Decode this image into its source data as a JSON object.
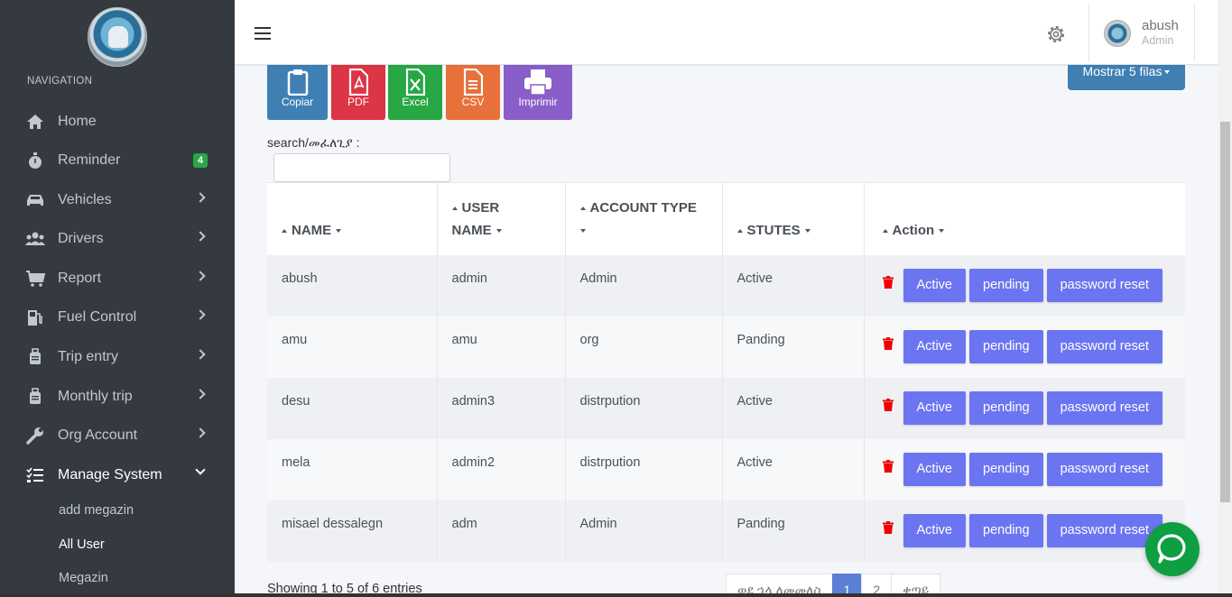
{
  "sidebar": {
    "nav_header": "NAVIGATION",
    "items": [
      {
        "label": "Home",
        "icon": "home-icon"
      },
      {
        "label": "Reminder",
        "icon": "stopwatch-icon",
        "badge": "4"
      },
      {
        "label": "Vehicles",
        "icon": "car-icon"
      },
      {
        "label": "Drivers",
        "icon": "users-icon"
      },
      {
        "label": "Report",
        "icon": "cart-icon"
      },
      {
        "label": "Fuel Control",
        "icon": "gas-pump-icon"
      },
      {
        "label": "Trip entry",
        "icon": "suitcase-icon"
      },
      {
        "label": "Monthly trip",
        "icon": "suitcase-icon"
      },
      {
        "label": "Org Account",
        "icon": "wrench-icon"
      },
      {
        "label": "Manage System",
        "icon": "tasks-icon"
      }
    ],
    "sub_items": [
      {
        "label": "add megazin"
      },
      {
        "label": "All User"
      },
      {
        "label": "Megazin"
      }
    ]
  },
  "topbar": {
    "user_name": "abush",
    "user_role": "Admin"
  },
  "toolbar": {
    "copy": "Copiar",
    "pdf": "PDF",
    "excel": "Excel",
    "csv": "CSV",
    "print": "Imprimir",
    "rows": "Mostrar 5 filas"
  },
  "search": {
    "label": "search/መፈለጊያ :",
    "value": ""
  },
  "table": {
    "headers": {
      "name": "NAME",
      "user_name_1": "USER",
      "user_name_2": "NAME",
      "account_type": "ACCOUNT TYPE",
      "status": "STUTES",
      "action": "Action"
    },
    "action_labels": {
      "active": "Active",
      "pending": "pending",
      "reset": "password reset"
    },
    "rows": [
      {
        "name": "abush",
        "user_name": "admin",
        "account_type": "Admin",
        "status": "Active"
      },
      {
        "name": "amu",
        "user_name": "amu",
        "account_type": "org",
        "status": "Panding"
      },
      {
        "name": "desu",
        "user_name": "admin3",
        "account_type": "distrpution",
        "status": "Active"
      },
      {
        "name": "mela",
        "user_name": "admin2",
        "account_type": "distrpution",
        "status": "Active"
      },
      {
        "name": "misael dessalegn",
        "user_name": "adm",
        "account_type": "Admin",
        "status": "Panding"
      }
    ]
  },
  "footer": {
    "info": "Showing 1 to 5 of 6 entries",
    "prev": "ወደ ኋላ ለመመለስ",
    "pages": [
      "1",
      "2"
    ],
    "next": "ቀጣይ"
  },
  "colors": {
    "sidebar_bg": "#343a40",
    "accent_button": "#6c75f1",
    "copy": "#3f7fb4",
    "pdf": "#dc3545",
    "excel": "#28a745",
    "csv": "#e8713b",
    "print": "#8a5ec9"
  }
}
